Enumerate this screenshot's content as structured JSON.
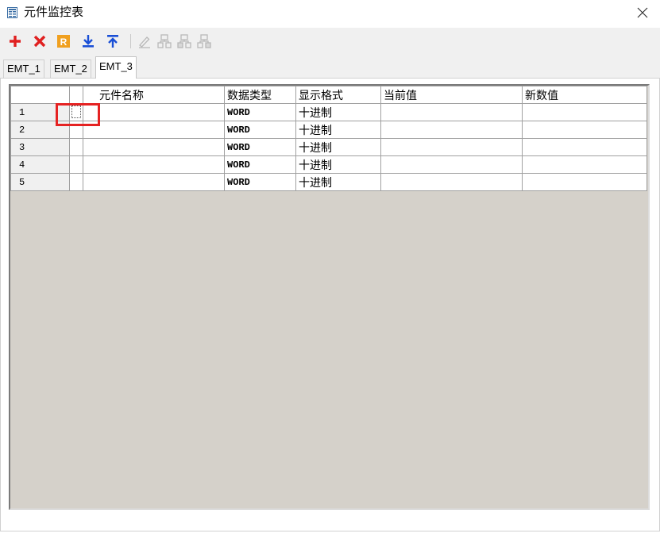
{
  "window": {
    "title": "元件监控表",
    "icon": "table-window-icon",
    "close_icon": "close-icon"
  },
  "toolbar": {
    "buttons": [
      {
        "name": "add-icon",
        "color": "#e02020"
      },
      {
        "name": "delete-icon",
        "color": "#e02020"
      },
      {
        "name": "register-icon",
        "letter": "R",
        "color": "#f0a020"
      },
      {
        "name": "download-icon",
        "color": "#1a4fd6"
      },
      {
        "name": "upload-icon",
        "color": "#1a4fd6"
      },
      {
        "name": "edit-icon",
        "disabled": true
      },
      {
        "name": "network-icon",
        "disabled": true
      },
      {
        "name": "network-left-icon",
        "disabled": true
      },
      {
        "name": "network-right-icon",
        "disabled": true
      }
    ]
  },
  "tabs": [
    {
      "label": "EMT_1",
      "active": false
    },
    {
      "label": "EMT_2",
      "active": false
    },
    {
      "label": "EMT_3",
      "active": true
    }
  ],
  "grid": {
    "columns": [
      "",
      "",
      "元件名称",
      "数据类型",
      "显示格式",
      "当前值",
      "新数值"
    ],
    "rows": [
      {
        "num": "1",
        "name": "",
        "type": "WORD",
        "format": "十进制",
        "current": "",
        "new": ""
      },
      {
        "num": "2",
        "name": "",
        "type": "WORD",
        "format": "十进制",
        "current": "",
        "new": ""
      },
      {
        "num": "3",
        "name": "",
        "type": "WORD",
        "format": "十进制",
        "current": "",
        "new": ""
      },
      {
        "num": "4",
        "name": "",
        "type": "WORD",
        "format": "十进制",
        "current": "",
        "new": ""
      },
      {
        "num": "5",
        "name": "",
        "type": "WORD",
        "format": "十进制",
        "current": "",
        "new": ""
      }
    ]
  },
  "colors": {
    "highlight": "#e52222",
    "grid_background": "#d5d1ca"
  }
}
